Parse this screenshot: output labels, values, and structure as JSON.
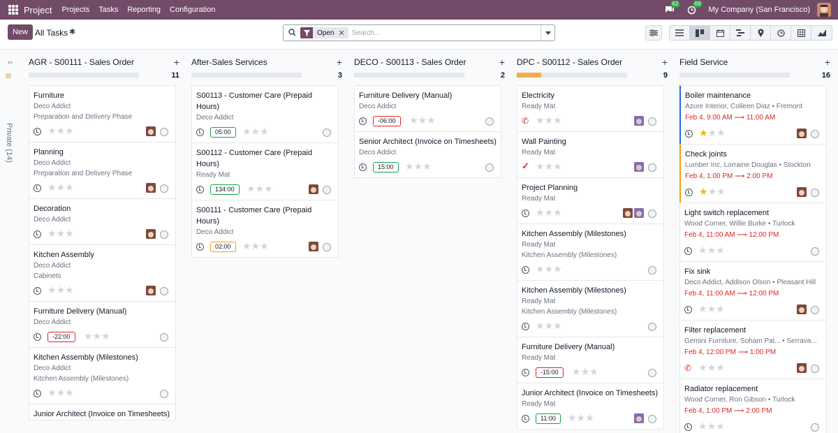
{
  "topnav": {
    "app_name": "Project",
    "menu": [
      "Projects",
      "Tasks",
      "Reporting",
      "Configuration"
    ],
    "messages_count": "62",
    "activities_count": "69",
    "company": "My Company (San Francisco)"
  },
  "control": {
    "new_label": "New",
    "title": "All Tasks",
    "facet_label": "Open",
    "search_placeholder": "Search..."
  },
  "folded_column": {
    "label": "Private (14)"
  },
  "columns": [
    {
      "title": "AGR - S00111 - Sales Order",
      "count": "11",
      "progress": 0,
      "cards": [
        {
          "title": "Furniture",
          "lines": [
            "Deco Addict",
            "Preparation and Delivery Phase"
          ],
          "deadline": "",
          "stars": 0,
          "avatar": true
        },
        {
          "title": "Planning",
          "lines": [
            "Deco Addict",
            "Preparation and Delivery Phase"
          ],
          "deadline": "",
          "stars": 0,
          "avatar": true
        },
        {
          "title": "Decoration",
          "lines": [
            "Deco Addict"
          ],
          "deadline": "",
          "stars": 0,
          "avatar": true
        },
        {
          "title": "Kitchen Assembly",
          "lines": [
            "Deco Addict",
            "Cabinets"
          ],
          "deadline": "",
          "stars": 0,
          "avatar": true
        },
        {
          "title": "Furniture Delivery (Manual)",
          "lines": [
            "Deco Addict"
          ],
          "deadline": "-22:00",
          "stars": 0,
          "avatar": false
        },
        {
          "title": "Kitchen Assembly (Milestones)",
          "lines": [
            "Deco Addict",
            "Kitchen Assembly (Milestones)"
          ],
          "deadline": "",
          "stars": 0,
          "avatar": false
        },
        {
          "title": "Junior Architect (Invoice on Timesheets)",
          "lines": [],
          "deadline": "",
          "stars": 0,
          "avatar": false
        }
      ]
    },
    {
      "title": "After-Sales Services",
      "count": "3",
      "progress": 0,
      "cards": [
        {
          "title": "S00113 - Customer Care (Prepaid Hours)",
          "lines": [
            "Deco Addict"
          ],
          "deadline": "05:00",
          "stars": 0,
          "avatar": false
        },
        {
          "title": "S00112 - Customer Care (Prepaid Hours)",
          "lines": [
            "Ready Mat"
          ],
          "deadline": "134:00",
          "stars": 0,
          "avatar": true
        },
        {
          "title": "S00111 - Customer Care (Prepaid Hours)",
          "lines": [
            "Deco Addict"
          ],
          "deadline": "02:00",
          "stars": 0,
          "avatar": true
        }
      ]
    },
    {
      "title": "DECO - S00113 - Sales Order",
      "count": "2",
      "progress": 0,
      "cards": [
        {
          "title": "Furniture Delivery (Manual)",
          "lines": [
            "Deco Addict"
          ],
          "deadline": "-06:00",
          "stars": 0,
          "avatar": false
        },
        {
          "title": "Senior Architect (Invoice on Timesheets)",
          "lines": [
            "Deco Addict"
          ],
          "deadline": "15:00",
          "stars": 0,
          "avatar": false
        }
      ]
    },
    {
      "title": "DPC - S00112 - Sales Order",
      "count": "9",
      "progress": 0.22,
      "cards": [
        {
          "title": "Electricity",
          "lines": [
            "Ready Mat"
          ],
          "deadline": "",
          "stars": 0,
          "avatar": true
        },
        {
          "title": "Wall Painting",
          "lines": [
            "Ready Mat"
          ],
          "deadline": "",
          "stars": 0,
          "avatar": true
        },
        {
          "title": "Project Planning",
          "lines": [
            "Ready Mat"
          ],
          "deadline": "",
          "stars": 0,
          "avatar": true
        },
        {
          "title": "Kitchen Assembly (Milestones)",
          "lines": [
            "Ready Mat",
            "Kitchen Assembly (Milestones)"
          ],
          "deadline": "",
          "stars": 0,
          "avatar": false
        },
        {
          "title": "Kitchen Assembly (Milestones)",
          "lines": [
            "Ready Mat",
            "Kitchen Assembly (Milestones)"
          ],
          "deadline": "",
          "stars": 0,
          "avatar": false
        },
        {
          "title": "Furniture Delivery (Manual)",
          "lines": [
            "Ready Mat"
          ],
          "deadline": "-15:00",
          "stars": 0,
          "avatar": false
        },
        {
          "title": "Junior Architect (Invoice on Timesheets)",
          "lines": [
            "Ready Mat"
          ],
          "deadline": "11:00",
          "stars": 0,
          "avatar": true
        }
      ]
    },
    {
      "title": "Field Service",
      "count": "16",
      "progress": 0,
      "cards": [
        {
          "title": "Boiler maintenance",
          "lines": [
            "Azure Interior, Colleen Diaz • Fremont"
          ],
          "date_from": "Feb 4, 9:00 AM",
          "date_to": "11:00 AM",
          "stars": 1,
          "avatar": true
        },
        {
          "title": "Check joints",
          "lines": [
            "Lumber Inc, Lorraine Douglas • Stockton"
          ],
          "date_from": "Feb 4, 1:00 PM",
          "date_to": "2:00 PM",
          "stars": 1,
          "avatar": true
        },
        {
          "title": "Light switch replacement",
          "lines": [
            "Wood Corner, Willie Burke • Turlock"
          ],
          "date_from": "Feb 4, 11:00 AM",
          "date_to": "12:00 PM",
          "stars": 0,
          "avatar": false
        },
        {
          "title": "Fix sink",
          "lines": [
            "Deco Addict, Addison Olson • Pleasant Hill"
          ],
          "date_from": "Feb 4, 11:00 AM",
          "date_to": "12:00 PM",
          "stars": 0,
          "avatar": true
        },
        {
          "title": "Filter replacement",
          "lines": [
            "Gemini Furniture, Soham Pal... • Serrava..."
          ],
          "date_from": "Feb 4, 12:00 PM",
          "date_to": "1:00 PM",
          "stars": 0,
          "avatar": true
        },
        {
          "title": "Radiator replacement",
          "lines": [
            "Wood Corner, Ron Gibson • Turlock"
          ],
          "date_from": "Feb 4, 1:00 PM",
          "date_to": "2:00 PM",
          "stars": 0,
          "avatar": false
        }
      ]
    }
  ],
  "colors": {
    "brand": "#714b67",
    "deadline_overdue": "#dc2626",
    "deadline_ok": "#16a34a",
    "deadline_soon": "#f59e0b",
    "progress_fill": "#f0ad4e"
  }
}
